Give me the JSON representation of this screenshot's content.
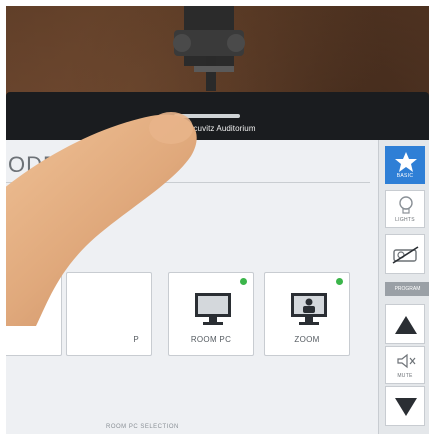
{
  "device": {
    "room_name": "Marcuvitz Auditorium"
  },
  "screen": {
    "mode_title": "ODE",
    "tiles": [
      {
        "label": "",
        "indicator_color": "#e83a3a",
        "icon": "document-camera-icon"
      },
      {
        "label": "P",
        "indicator_color": "",
        "icon": "laptop-icon"
      },
      {
        "label": "ROOM PC",
        "indicator_color": "#3bb54a",
        "icon": "monitor-icon"
      },
      {
        "label": "ZOOM",
        "indicator_color": "#3bb54a",
        "icon": "video-conference-icon"
      }
    ],
    "bottom_text": "ROOM PC SELECTION"
  },
  "sidebar": {
    "basic_label": "BASIC",
    "lights_label": "LIGHTS",
    "program_label": "PROGRAM",
    "mute_label": "MUTE",
    "accent_color": "#2e7fd6"
  }
}
